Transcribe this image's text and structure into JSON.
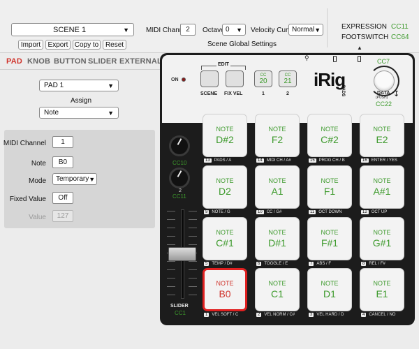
{
  "header": {
    "scene_select": "SCENE 1",
    "buttons": [
      "Import",
      "Export",
      "Copy to",
      "Reset"
    ],
    "midi_channel_label": "MIDI Channel",
    "midi_channel_value": "2",
    "octave_label": "Octave",
    "octave_value": "0",
    "velocity_curve_label": "Velocity Curve",
    "velocity_curve_value": "Normal",
    "scene_global_settings": "Scene Global Settings",
    "expression_label": "EXPRESSION",
    "expression_cc": "CC11",
    "footswitch_label": "FOOTSWITCH",
    "footswitch_cc": "CC64"
  },
  "tabs": [
    "PAD",
    "KNOB",
    "BUTTON",
    "SLIDER",
    "EXTERNAL"
  ],
  "left_panel": {
    "pad_select": "PAD 1",
    "assign_label": "Assign",
    "assign_value": "Note",
    "midi_channel_label": "MIDI Channel",
    "midi_channel_value": "1",
    "note_label": "Note",
    "note_value": "B0",
    "mode_label": "Mode",
    "mode_value": "Temporary",
    "fixed_value_label": "Fixed Value",
    "fixed_value_value": "Off",
    "value_label": "Value",
    "value_value": "127"
  },
  "device": {
    "on_label": "ON",
    "edit_label": "EDIT",
    "scene_btn": "SCENE",
    "fix_vel_btn": "FIX VEL",
    "cc_btn1": {
      "cc": "CC",
      "num": "20",
      "label": "1"
    },
    "cc_btn2": {
      "cc": "CC",
      "num": "21",
      "label": "2"
    },
    "brand": "iRig",
    "brand_sub": "PADS",
    "data_label": "DATA",
    "data_push": "(PUSH)",
    "data_cc_top": "CC7",
    "data_cc_bottom": "CC22",
    "knob1_cc": "CC10",
    "knob2_label": "2",
    "knob2_cc": "CC11",
    "slider_label": "SLIDER",
    "slider_cc": "CC1",
    "pads": [
      {
        "t1": "NOTE",
        "t2": "D#2",
        "num": "13",
        "label": "PADS / A"
      },
      {
        "t1": "NOTE",
        "t2": "F2",
        "num": "14",
        "label": "MIDI CH / A#"
      },
      {
        "t1": "NOTE",
        "t2": "C#2",
        "num": "15",
        "label": "PROG CH / B"
      },
      {
        "t1": "NOTE",
        "t2": "E2",
        "num": "16",
        "label": "ENTER / YES"
      },
      {
        "t1": "NOTE",
        "t2": "D2",
        "num": "9",
        "label": "NOTE / G"
      },
      {
        "t1": "NOTE",
        "t2": "A1",
        "num": "10",
        "label": "CC / G#"
      },
      {
        "t1": "NOTE",
        "t2": "F1",
        "num": "11",
        "label": "OCT DOWN"
      },
      {
        "t1": "NOTE",
        "t2": "A#1",
        "num": "12",
        "label": "OCT UP"
      },
      {
        "t1": "NOTE",
        "t2": "C#1",
        "num": "5",
        "label": "TEMP / D#"
      },
      {
        "t1": "NOTE",
        "t2": "D#1",
        "num": "6",
        "label": "TOGGLE / E"
      },
      {
        "t1": "NOTE",
        "t2": "F#1",
        "num": "7",
        "label": "ABS / F"
      },
      {
        "t1": "NOTE",
        "t2": "G#1",
        "num": "8",
        "label": "REL / F#"
      },
      {
        "t1": "NOTE",
        "t2": "B0",
        "num": "1",
        "label": "VEL SOFT / C"
      },
      {
        "t1": "NOTE",
        "t2": "C1",
        "num": "2",
        "label": "VEL NORM / C#"
      },
      {
        "t1": "NOTE",
        "t2": "D1",
        "num": "3",
        "label": "VEL HARD / D"
      },
      {
        "t1": "NOTE",
        "t2": "E1",
        "num": "4",
        "label": "CANCEL / NO"
      }
    ]
  },
  "icons": [
    "chevron-down-icon",
    "usb-icon",
    "expression-jack-icon",
    "footswitch-jack-icon",
    "up-arrow-icon",
    "knob-rotate-icon"
  ],
  "colors": {
    "accent_red": "#d0342c",
    "cc_green": "#3d9a2c",
    "device_body": "#1c1c1c"
  }
}
